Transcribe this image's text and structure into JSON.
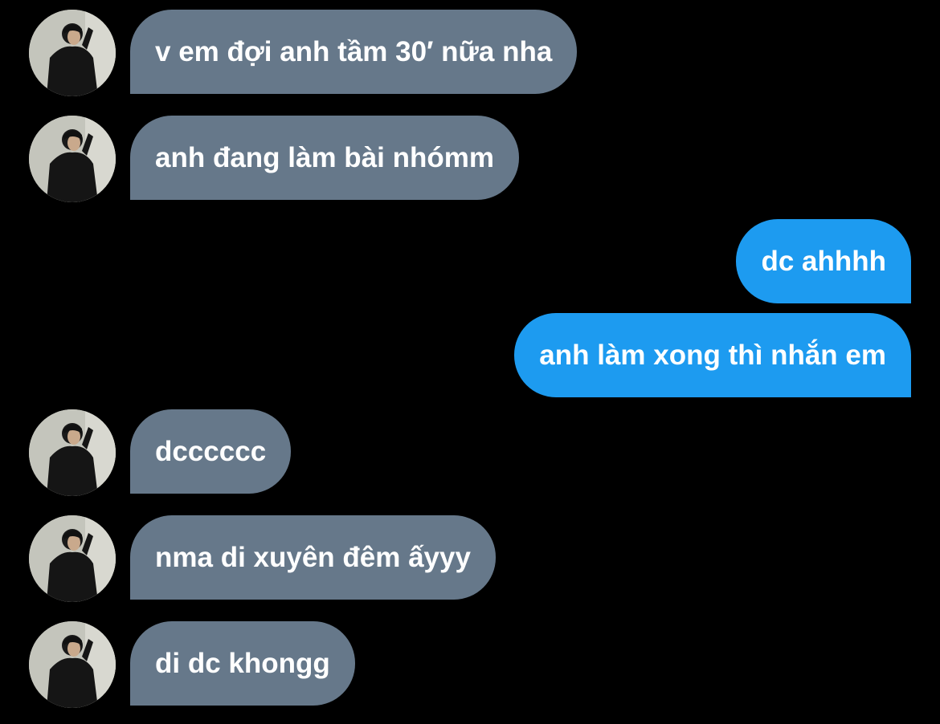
{
  "colors": {
    "background": "#000000",
    "received_bubble": "#66788a",
    "sent_bubble": "#1d9bf0",
    "text": "#ffffff"
  },
  "messages": [
    {
      "sender": "other",
      "text": "v em đợi anh tầm 30′ nữa nha"
    },
    {
      "sender": "other",
      "text": "anh đang làm bài nhómm"
    },
    {
      "sender": "me",
      "text": "dc ahhhh"
    },
    {
      "sender": "me",
      "text": "anh làm xong thì nhắn em"
    },
    {
      "sender": "other",
      "text": "dcccccc"
    },
    {
      "sender": "other",
      "text": "nma di xuyên đêm ấyyy"
    },
    {
      "sender": "other",
      "text": "di dc khongg"
    }
  ],
  "avatar": {
    "icon": "profile-photo-avatar"
  }
}
